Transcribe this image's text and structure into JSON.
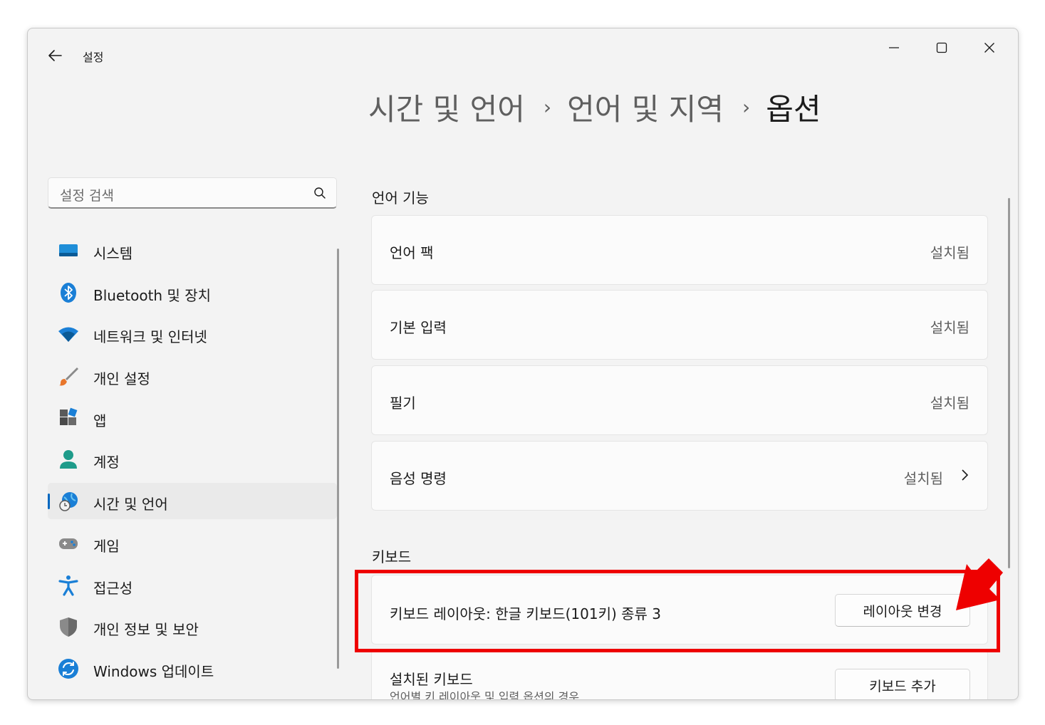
{
  "window": {
    "title": "설정"
  },
  "header": {
    "crumbs": [
      "시간 및 언어",
      "언어 및 지역"
    ],
    "current": "옵션",
    "separator": "›"
  },
  "search": {
    "placeholder": "설정 검색"
  },
  "sidebar": {
    "items": [
      {
        "label": "시스템",
        "icon": "system-icon"
      },
      {
        "label": "Bluetooth 및 장치",
        "icon": "bluetooth-icon"
      },
      {
        "label": "네트워크 및 인터넷",
        "icon": "wifi-icon"
      },
      {
        "label": "개인 설정",
        "icon": "brush-icon"
      },
      {
        "label": "앱",
        "icon": "apps-icon"
      },
      {
        "label": "계정",
        "icon": "account-icon"
      },
      {
        "label": "시간 및 언어",
        "icon": "time-language-icon",
        "active": true
      },
      {
        "label": "게임",
        "icon": "gamepad-icon"
      },
      {
        "label": "접근성",
        "icon": "accessibility-icon"
      },
      {
        "label": "개인 정보 및 보안",
        "icon": "shield-icon"
      },
      {
        "label": "Windows 업데이트",
        "icon": "update-icon"
      }
    ]
  },
  "language_features": {
    "title": "언어 기능",
    "items": [
      {
        "label": "언어 팩",
        "value": "설치됨"
      },
      {
        "label": "기본 입력",
        "value": "설치됨"
      },
      {
        "label": "필기",
        "value": "설치됨"
      },
      {
        "label": "음성 명령",
        "value": "설치됨"
      }
    ]
  },
  "keyboard": {
    "title": "키보드",
    "layout_label": "키보드 레이아웃: 한글 키보드(101키) 종류 3",
    "layout_button": "레이아웃 변경",
    "installed_label": "설치된 키보드",
    "installed_sub": "언어별 키 레이아웃 및 입력 옵션의 경우",
    "installed_button": "키보드 추가"
  },
  "colors": {
    "accent": "#0067c0",
    "highlight": "#ee0000"
  }
}
